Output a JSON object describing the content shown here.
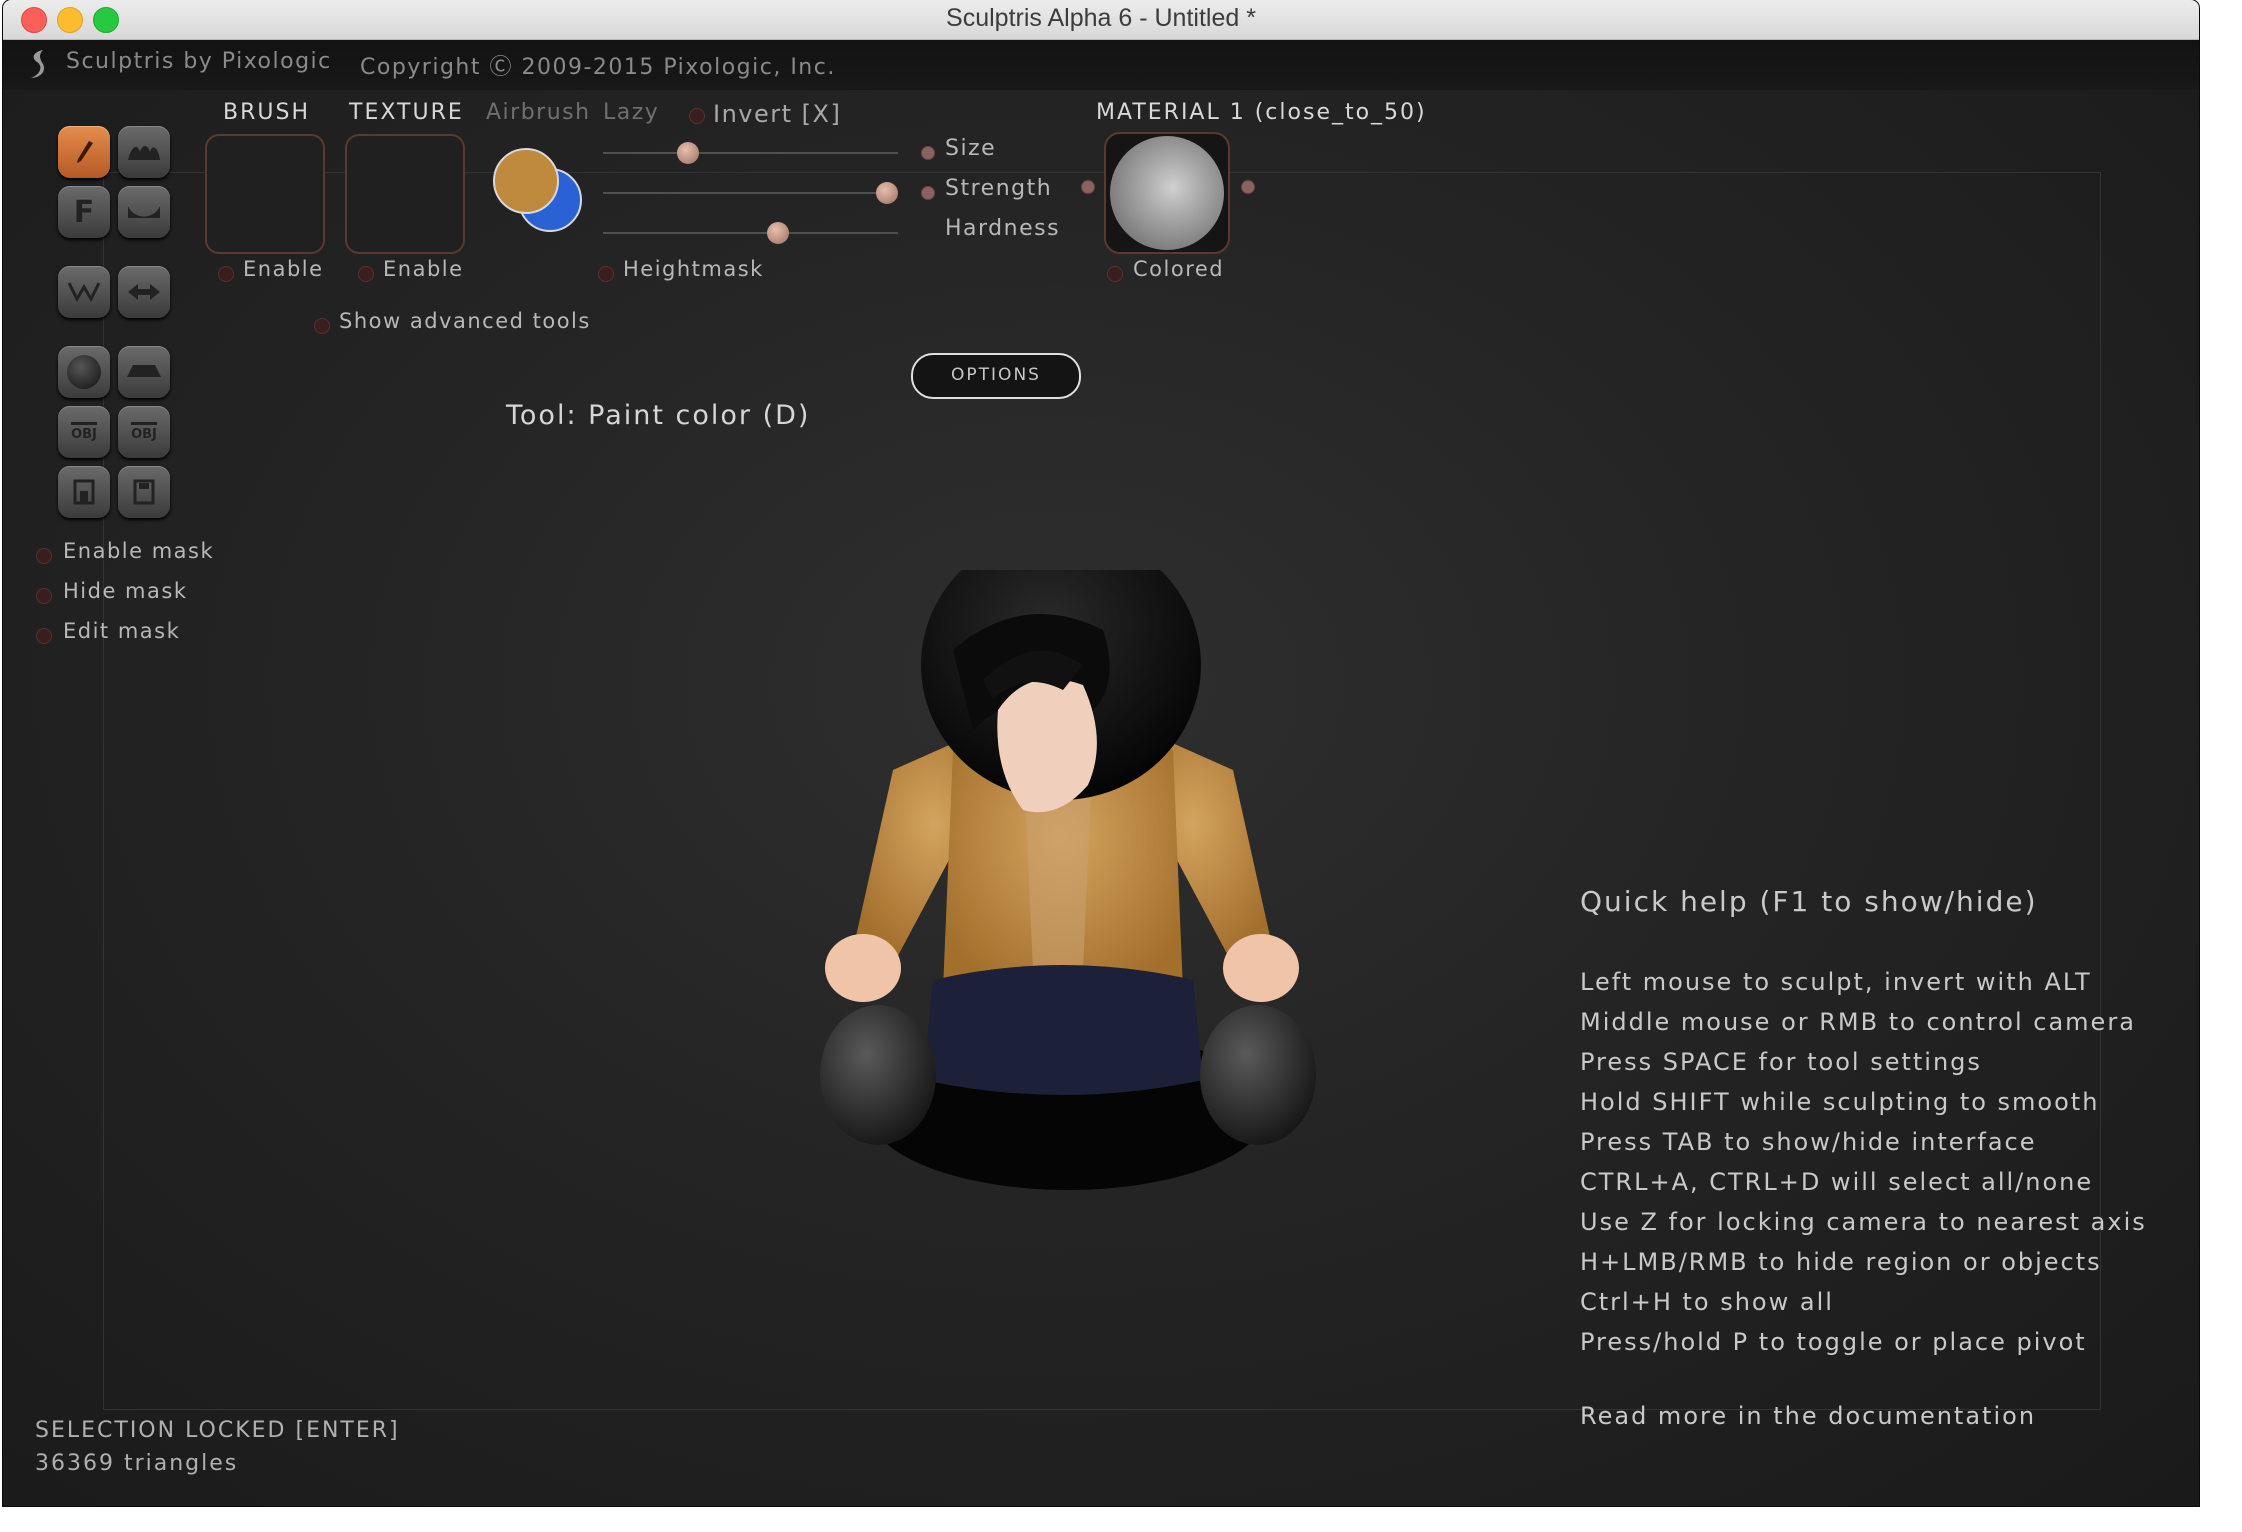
{
  "window": {
    "title": "Sculptris Alpha 6 - Untitled *"
  },
  "appbar": {
    "app_name": "Sculptris by Pixologic",
    "copyright": "Copyright Ⓒ 2009-2015 Pixologic, Inc."
  },
  "toolbox": {
    "buttons": [
      {
        "icon": "paint-brush-icon",
        "active": true
      },
      {
        "icon": "draw-stroke-icon",
        "active": false
      },
      {
        "icon": "flatten-icon",
        "glyph": "F",
        "active": false
      },
      {
        "icon": "crease-icon",
        "active": false
      },
      {
        "icon": "pinch-icon",
        "active": false
      },
      {
        "icon": "grab-icon",
        "active": false
      },
      {
        "icon": "sphere-icon",
        "active": false
      },
      {
        "icon": "plane-icon",
        "active": false
      },
      {
        "icon": "import-obj-icon",
        "glyph": "OBJ",
        "active": false
      },
      {
        "icon": "export-obj-icon",
        "glyph": "OBJ",
        "active": false
      },
      {
        "icon": "open-file-icon",
        "active": false
      },
      {
        "icon": "save-file-icon",
        "active": false
      }
    ]
  },
  "mask": {
    "enable": "Enable mask",
    "hide": "Hide mask",
    "edit": "Edit mask"
  },
  "brush_panel": {
    "brush_label": "BRUSH",
    "texture_label": "TEXTURE",
    "airbrush_label": "Airbrush",
    "lazy_label": "Lazy",
    "invert_label": "Invert [X]",
    "brush_enable": "Enable",
    "texture_enable": "Enable",
    "heightmask": "Heightmask",
    "show_advanced": "Show advanced tools",
    "size_label": "Size",
    "strength_label": "Strength",
    "hardness_label": "Hardness",
    "size_value": 0.27,
    "strength_value": 1.0,
    "hardness_value": 0.6,
    "options_label": "OPTIONS",
    "primary_color": "#c08a3e",
    "secondary_color": "#2a62d6"
  },
  "material_panel": {
    "title": "MATERIAL 1 (close_to_50)",
    "colored_label": "Colored"
  },
  "tool": {
    "current": "Tool: Paint color (D)"
  },
  "quick_help": {
    "title": "Quick help (F1 to show/hide)",
    "lines": [
      "Left mouse to sculpt, invert with ALT",
      "Middle mouse or RMB to control camera",
      "Press SPACE for tool settings",
      "Hold SHIFT while sculpting to smooth",
      "Press TAB to show/hide interface",
      "CTRL+A, CTRL+D will select all/none",
      "Use Z for locking camera to nearest axis",
      "H+LMB/RMB to hide region or objects",
      "Ctrl+H to show all",
      "Press/hold P to toggle or place pivot"
    ],
    "more": "Read more in the documentation"
  },
  "status": {
    "selection": "SELECTION LOCKED [ENTER]",
    "triangles": "36369 triangles"
  }
}
